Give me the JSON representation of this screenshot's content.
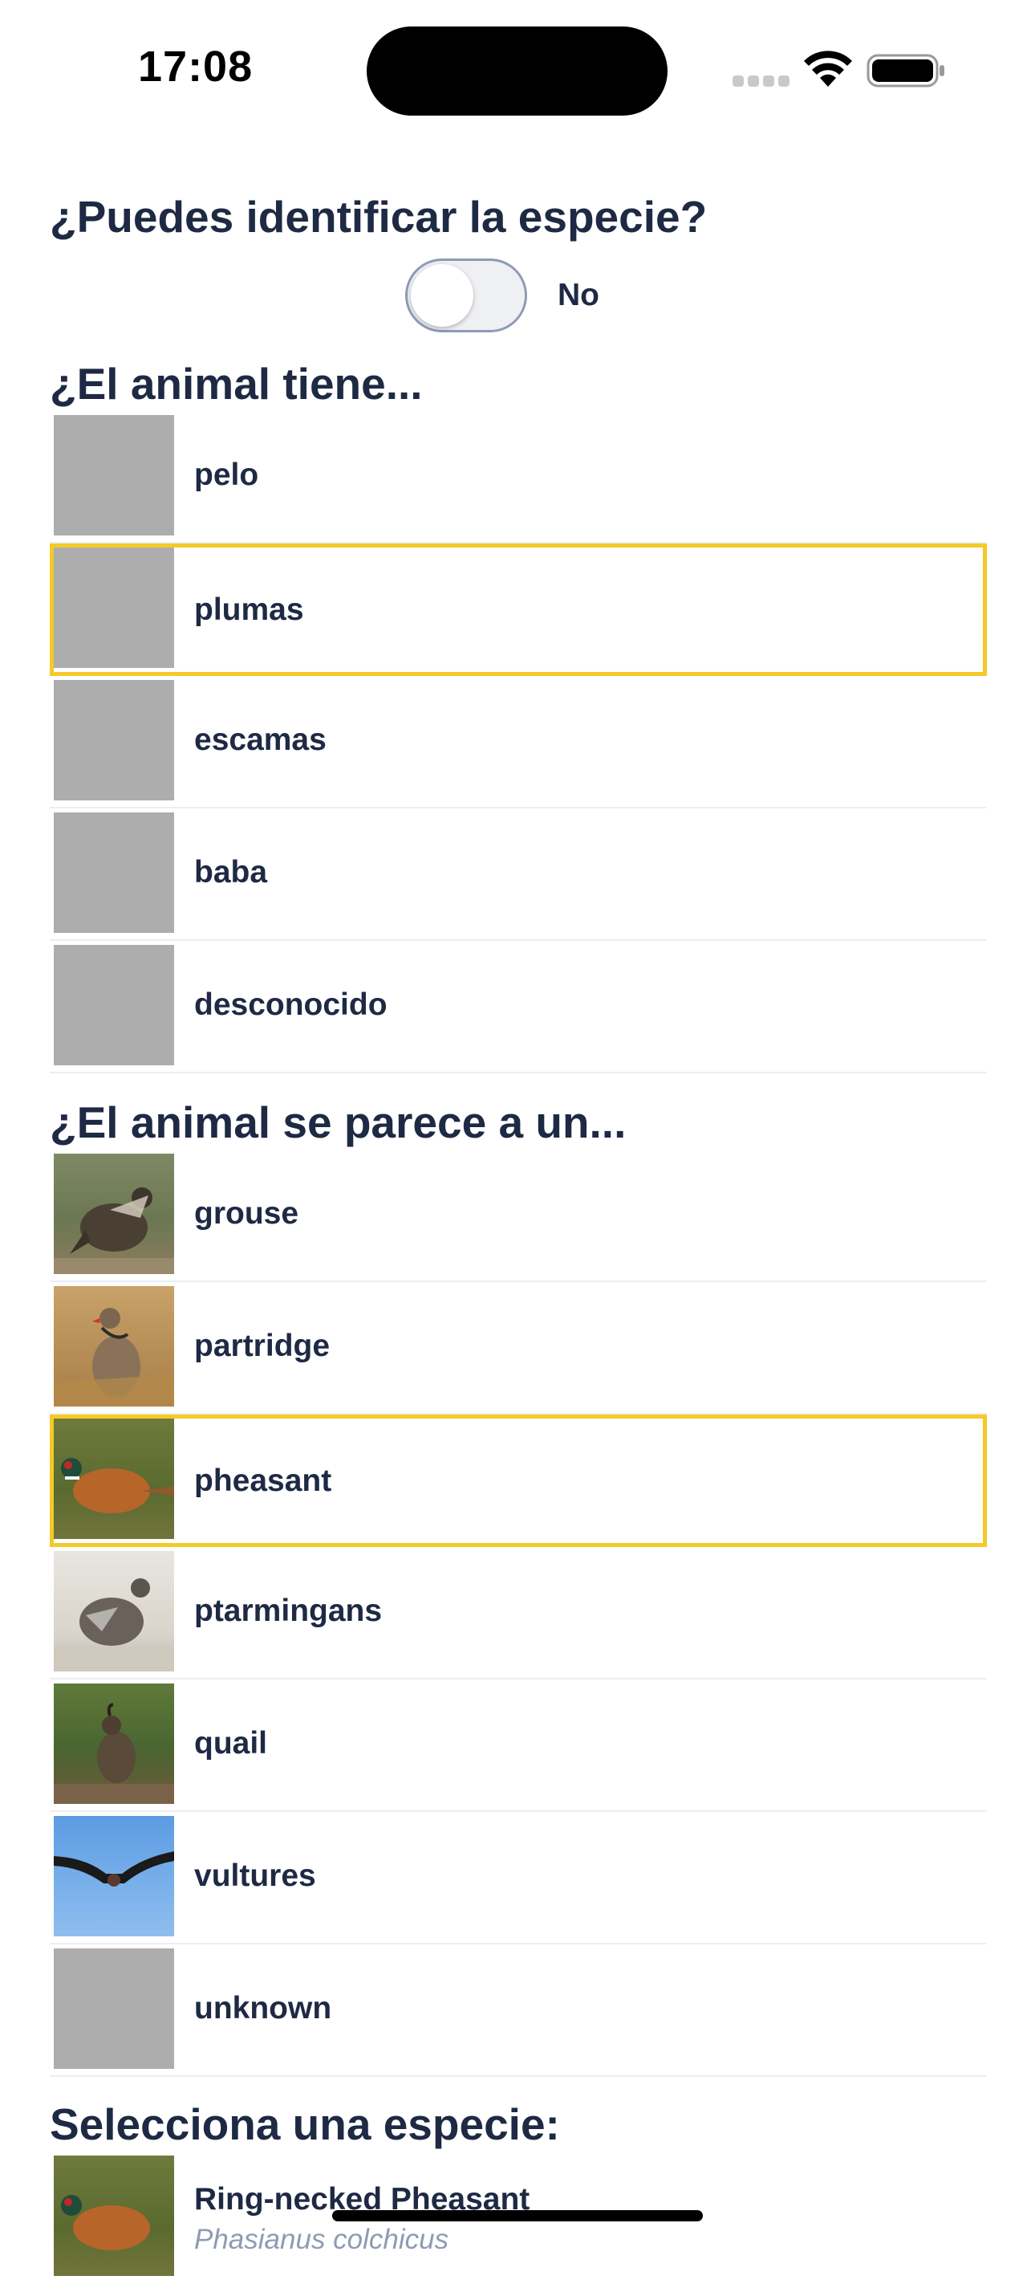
{
  "status_bar": {
    "time": "17:08"
  },
  "identify": {
    "question": "¿Puedes identificar la especie?",
    "toggle_label": "No",
    "toggle_on": false
  },
  "traits": {
    "title": "¿El animal tiene...",
    "items": [
      {
        "label": "pelo",
        "selected": false
      },
      {
        "label": "plumas",
        "selected": true
      },
      {
        "label": "escamas",
        "selected": false
      },
      {
        "label": "baba",
        "selected": false
      },
      {
        "label": "desconocido",
        "selected": false
      }
    ]
  },
  "resembles": {
    "title": "¿El animal se parece a un...",
    "items": [
      {
        "label": "grouse",
        "selected": false,
        "photo": "grouse-photo"
      },
      {
        "label": "partridge",
        "selected": false,
        "photo": "partridge-photo"
      },
      {
        "label": "pheasant",
        "selected": true,
        "photo": "pheasant-photo"
      },
      {
        "label": "ptarmingans",
        "selected": false,
        "photo": "ptarmigan-photo"
      },
      {
        "label": "quail",
        "selected": false,
        "photo": "quail-photo"
      },
      {
        "label": "vultures",
        "selected": false,
        "photo": "vulture-photo"
      },
      {
        "label": "unknown",
        "selected": false,
        "photo": null
      }
    ]
  },
  "species": {
    "title": "Selecciona una especie:",
    "items": [
      {
        "name": "Ring-necked Pheasant",
        "scientific": "Phasianus colchicus"
      }
    ]
  },
  "colors": {
    "text": "#1e2a44",
    "selected_border": "#f5c928",
    "placeholder": "#adadad",
    "muted": "#8f9bb3"
  }
}
